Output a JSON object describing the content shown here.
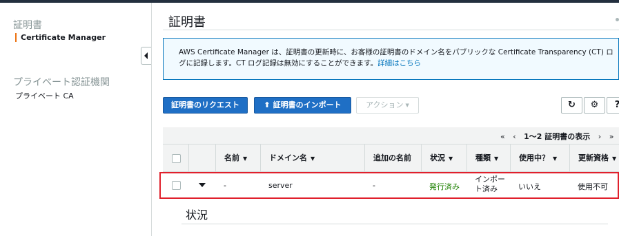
{
  "sidebar": {
    "section1_title": "証明書",
    "section1_item": "Certificate Manager",
    "section2_title": "プライベート認証機関",
    "section2_item": "プライベート CA"
  },
  "main": {
    "title": "証明書",
    "info": {
      "text": "AWS Certificate Manager は、証明書の更新時に、お客様の証明書のドメイン名をパブリックな Certificate Transparency (CT) ログに記録します。CT ログ記録は無効にすることができます。",
      "link": "詳細はこちら"
    },
    "buttons": {
      "request": "証明書のリクエスト",
      "import": "証明書のインポート",
      "actions": "アクション"
    },
    "pager": {
      "first": "«",
      "prev": "‹",
      "label": "1〜2 証明書の表示",
      "next": "›",
      "last": "»"
    },
    "table": {
      "headers": [
        "名前",
        "ドメイン名",
        "追加の名前",
        "状況",
        "種類",
        "使用中？",
        "更新資格"
      ],
      "row": {
        "name": "-",
        "domain": "server",
        "additional": "-",
        "status": "発行済み",
        "type_line1": "インポー",
        "type_line2": "ト済み",
        "in_use": "いいえ",
        "renewal": "使用不可"
      }
    },
    "detail_heading": "状況"
  },
  "colors": {
    "accent": "#ec7211",
    "primary_button": "#1f6fc5",
    "info_border": "#0073bb",
    "status_green": "#1d8102",
    "highlight_red": "#e0202c"
  },
  "icons": [
    "refresh-icon",
    "gear-icon",
    "help-icon",
    "upload-icon",
    "chevron-down-icon",
    "collapse-left-icon"
  ]
}
